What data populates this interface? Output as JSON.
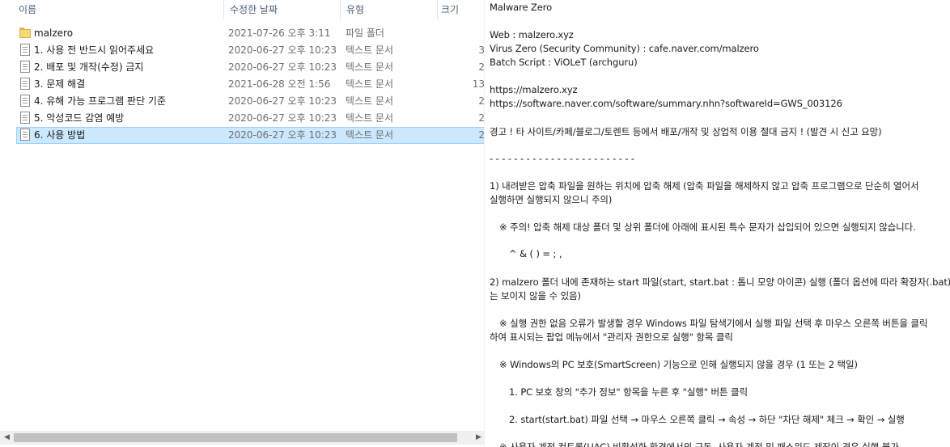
{
  "columns": {
    "name": "이름",
    "date": "수정한 날짜",
    "type": "유형",
    "size": "크기",
    "sort_indicator": "^"
  },
  "files": [
    {
      "icon": "folder-icon",
      "name": "malzero",
      "date": "2021-07-26 오후 3:11",
      "type": "파일 폴더",
      "size": "",
      "selected": false
    },
    {
      "icon": "text-document-icon",
      "name": "1. 사용 전 반드시 읽어주세요",
      "date": "2020-06-27 오후 10:23",
      "type": "텍스트 문서",
      "size": "3",
      "selected": false
    },
    {
      "icon": "text-document-icon",
      "name": "2. 배포 및 개작(수정) 금지",
      "date": "2020-06-27 오후 10:23",
      "type": "텍스트 문서",
      "size": "2",
      "selected": false
    },
    {
      "icon": "text-document-icon",
      "name": "3. 문제 해결",
      "date": "2021-06-28 오전 1:56",
      "type": "텍스트 문서",
      "size": "13",
      "selected": false
    },
    {
      "icon": "text-document-icon",
      "name": "4. 유해 가능 프로그램 판단 기준",
      "date": "2020-06-27 오후 10:23",
      "type": "텍스트 문서",
      "size": "2",
      "selected": false
    },
    {
      "icon": "text-document-icon",
      "name": "5. 악성코드 감염 예방",
      "date": "2020-06-27 오후 10:23",
      "type": "텍스트 문서",
      "size": "2",
      "selected": false
    },
    {
      "icon": "text-document-icon",
      "name": "6. 사용 방법",
      "date": "2020-06-27 오후 10:23",
      "type": "텍스트 문서",
      "size": "2",
      "selected": true
    }
  ],
  "preview_lines": [
    "Malware Zero",
    "Web : malzero.xyz",
    "Virus Zero (Security Community) : cafe.naver.com/malzero",
    "Batch Script : ViOLeT (archguru)",
    "https://malzero.xyz",
    "https://software.naver.com/software/summary.nhn?softwareId=GWS_003126",
    "경고 ! 타 사이트/카페/블로그/토렌트 등에서 배포/개작 및 상업적 이용 절대 금지 ! (발견 시 신고 요망)",
    "- - - - - - - - - - - - - - - - - - - - - - - -",
    "1) 내려받은 압축 파일을 원하는 위치에 압축 해제 (압축 파일을 해제하지 않고 압축 프로그램으로 단순히 열어서",
    "실행하면 실행되지 않으니 주의)",
    "※ 주의! 압축 해제 대상 폴더 및 상위 폴더에 아래에 표시된 특수 문자가 삽입되어 있으면 실행되지 않습니다.",
    "^ & ( ) = ; ,",
    "2) malzero 폴더 내에 존재하는 start 파일(start, start.bat : 톱니 모양 아이콘) 실행 (폴더 옵션에 따라 확장자(.bat)",
    "는 보이지 않을 수 있음)",
    "※ 실행 권한 없음 오류가 발생할 경우 Windows 파일 탐색기에서 실행 파일 선택 후 마우스 오른쪽 버튼을 클릭",
    "하여 표시되는 팝업 메뉴에서 \"관리자 권한으로 실행\" 항목 클릭",
    "※ Windows의 PC 보호(SmartScreen) 기능으로 인해 실행되지 않을 경우 (1 또는 2 택일)",
    "1. PC 보호 창의 \"추가 정보\" 항목을 누른 후 \"실행\" 버튼 클릭",
    "2. start(start.bat) 파일 선택 → 마우스 오른쪽 클릭 → 속성 → 하단 \"차단 해제\" 체크 → 확인 → 실행",
    "※ 사용자 계정 컨트롤(UAC) 비활성화 환경에서의 구동, 사용자 계정 및 패스워드 제작이 경우 실행 불가"
  ],
  "scrollbar": {
    "left_arrow": "◀",
    "right_arrow": "▶"
  }
}
